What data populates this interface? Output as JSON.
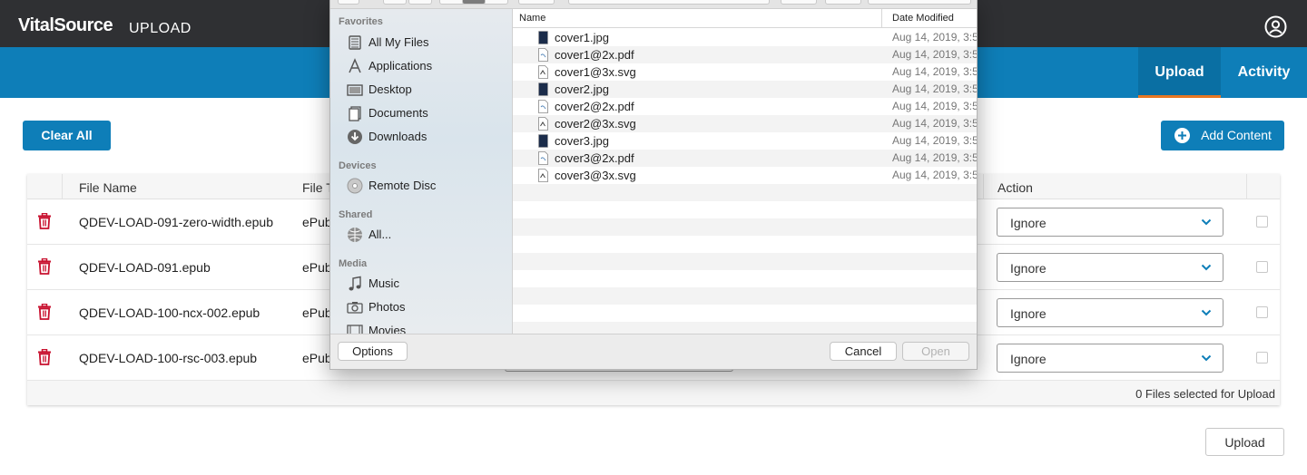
{
  "header": {
    "brand": "VitalSource",
    "product": "UPLOAD",
    "tabs": [
      {
        "label": "Upload",
        "active": true
      },
      {
        "label": "Activity",
        "active": false
      }
    ]
  },
  "toolbar": {
    "clear_all_label": "Clear All",
    "add_content_label": "Add Content"
  },
  "table": {
    "columns": {
      "file_name": "File Name",
      "file_type": "File T",
      "action": "Action"
    },
    "rows": [
      {
        "file_name": "QDEV-LOAD-091-zero-width.epub",
        "file_type": "ePub",
        "action": "Ignore"
      },
      {
        "file_name": "QDEV-LOAD-091.epub",
        "file_type": "ePub",
        "action": "Ignore"
      },
      {
        "file_name": "QDEV-LOAD-100-ncx-002.epub",
        "file_type": "ePub",
        "action": "Ignore"
      },
      {
        "file_name": "QDEV-LOAD-100-rsc-003.epub",
        "file_type": "ePub",
        "action": "Ignore"
      }
    ],
    "footer": "0 Files selected for Upload"
  },
  "upload_label": "Upload",
  "file_dialog": {
    "sidebar": {
      "favorites_heading": "Favorites",
      "favorites": [
        "All My Files",
        "Applications",
        "Desktop",
        "Documents",
        "Downloads"
      ],
      "devices_heading": "Devices",
      "devices": [
        "Remote Disc"
      ],
      "shared_heading": "Shared",
      "shared": [
        "All..."
      ],
      "media_heading": "Media",
      "media": [
        "Music",
        "Photos",
        "Movies"
      ]
    },
    "columns": {
      "name": "Name",
      "date_modified": "Date Modified"
    },
    "files": [
      {
        "name": "cover1.jpg",
        "kind": "jpg",
        "date": "Aug 14, 2019, 3:5"
      },
      {
        "name": "cover1@2x.pdf",
        "kind": "pdf",
        "date": "Aug 14, 2019, 3:5"
      },
      {
        "name": "cover1@3x.svg",
        "kind": "svg",
        "date": "Aug 14, 2019, 3:5"
      },
      {
        "name": "cover2.jpg",
        "kind": "jpg",
        "date": "Aug 14, 2019, 3:5"
      },
      {
        "name": "cover2@2x.pdf",
        "kind": "pdf",
        "date": "Aug 14, 2019, 3:5"
      },
      {
        "name": "cover2@3x.svg",
        "kind": "svg",
        "date": "Aug 14, 2019, 3:5"
      },
      {
        "name": "cover3.jpg",
        "kind": "jpg",
        "date": "Aug 14, 2019, 3:5"
      },
      {
        "name": "cover3@2x.pdf",
        "kind": "pdf",
        "date": "Aug 14, 2019, 3:5"
      },
      {
        "name": "cover3@3x.svg",
        "kind": "svg",
        "date": "Aug 14, 2019, 3:5"
      }
    ],
    "options_label": "Options",
    "cancel_label": "Cancel",
    "open_label": "Open"
  }
}
